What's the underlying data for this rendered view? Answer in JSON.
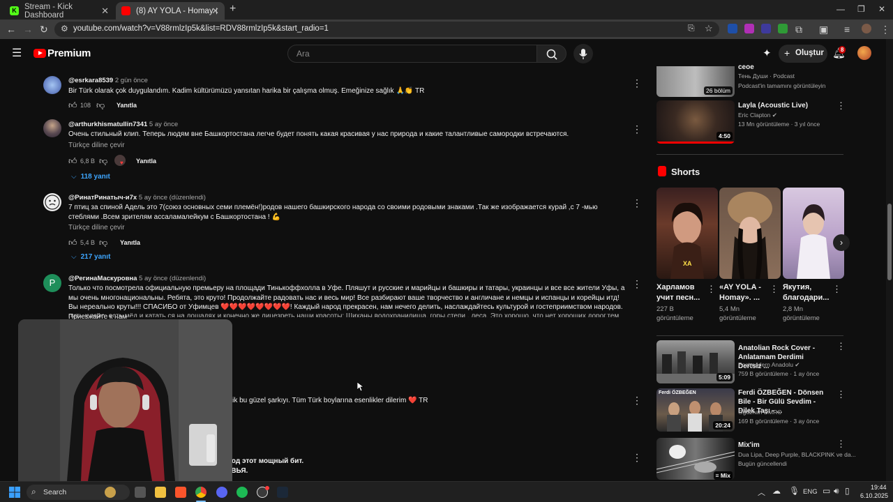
{
  "browser": {
    "tabs": [
      {
        "title": "Stream - Kick Dashboard",
        "active": false
      },
      {
        "title": "(8) AY YOLA - Homay (Премьер",
        "active": true
      }
    ],
    "url": "youtube.com/watch?v=V88rmlzIp5k&list=RDV88rmlzIp5k&start_radio=1"
  },
  "youtube": {
    "logo_text": "Premium",
    "search_placeholder": "Ara",
    "create_label": "Oluştur",
    "notification_count": "8"
  },
  "comments": [
    {
      "author": "@esrkara8539",
      "time": "2 gün önce",
      "text": "Bir Türk olarak çok duygulandım. Kadim kültürümüzü yansıtan harika bir çalışma olmuş. Emeğinize sağlık 🙏👏 TR",
      "likes": "108",
      "reply_label": "Yanıtla"
    },
    {
      "author": "@arthurkhismatullin7341",
      "time": "5 ay önce",
      "text": "Очень стильный клип. Теперь людям вне Башкортостана легче будет понять какая красивая у нас природа и какие талантливые самородки встречаются.",
      "translate": "Türkçe diline çevir",
      "likes": "6,8 B",
      "reply_label": "Yanıtla",
      "replies": "118 yanıt"
    },
    {
      "author": "@РинатРинатыч-и7х",
      "time": "5 ay önce (düzenlendi)",
      "text": "7 птиц за спиной Адель это 7(союз основных семи племён!)родов нашего башкирского народа со своими родовыми знаками .Так же изображается курай ,с 7 -мью стеблями .Всем зрителям ассаламалейкум с Башкортостана ! 💪",
      "translate": "Türkçe diline çevir",
      "likes": "5,4 B",
      "reply_label": "Yanıtla",
      "replies": "217 yanıt"
    },
    {
      "author": "@РегинаМаскуровна",
      "time": "5 ay önce (düzenlendi)",
      "text": "Только что посмотрела  официальную премьеру на площади Тинькоффхолла в Уфе. Пляшут и русские и марийцы и башкиры и татары, украинцы и все все жители Уфы, а мы очень многонациональны. Ребята, это круто! Продолжайте радовать нас  и весь мир! Все  разбирают  ваше творчество и англичане и немцы и испанцы и корейцы итд! Вы нереально круты!!! СПАСИБО от Уфимцев ❤️❤️❤️❤️❤️❤️❤️❤️! Каждый народ прекрасен, нам нечего делить, наслаждайтесь культурой и гостеприимством народов. Приезжайте к нам",
      "text_cut": "пить кумыс ,есть мёд и катать ся на лошадях и конечно же лицезреть наши красоты: Шиханы,водохранилища, горы,степи , леса. Это хорошо, что нет хороших дорог,тем самым эти ..."
    },
    {
      "text": "settik bu güzel şarkıyı. Tüm Türk boylarına esenlikler dilerim ❤️ TR"
    },
    {
      "text_line1": "р под этот мощный бит.",
      "text_line2": "РОВЬЯ."
    }
  ],
  "sidebar": {
    "top_items": [
      {
        "title": "сеое",
        "channel": "Тень Души · Podcast",
        "meta": "Podcast'in tamamını görüntüleyin",
        "badge": "26 bölüm"
      },
      {
        "title": "Layla (Acoustic Live)",
        "channel": "Eric Clapton",
        "meta": "13 Mn görüntüleme · 3 yıl önce",
        "duration": "4:50"
      }
    ],
    "shorts_header": "Shorts",
    "shorts": [
      {
        "title": "Харламов учит песн...",
        "views": "227 B görüntüleme",
        "overlay": "ХА"
      },
      {
        "title": "«AY YOLA - Homay». ...",
        "views": "5,4 Mn görüntüleme"
      },
      {
        "title": "Якутия, благодари...",
        "views": "2,8 Mn görüntüleme"
      }
    ],
    "bottom_items": [
      {
        "title": "Anatolian Rock Cover - Anlatamam Derdimi Dertsiz ...",
        "channel": "Postmodern Anadolu",
        "meta": "759 B görüntüleme · 1 ay önce",
        "duration": "5:09"
      },
      {
        "title": "Ferdi ÖZBEĞEN - Dönsen Bile - Bir Gülü Sevdim - Dilek Taşı - ...",
        "channel": "Oğuzhan DMRC",
        "meta": "169 B görüntüleme · 3 ay önce",
        "duration": "20:24",
        "thumb_text": "Ferdi ÖZBEĞEN"
      },
      {
        "title": "Mix'im",
        "channel": "Dua Lipa, Deep Purple, BLACKPINK ve da...",
        "meta": "Bugün güncellendi",
        "duration": "Mix"
      }
    ]
  },
  "taskbar": {
    "search_label": "Search",
    "lang": "ENG",
    "time": "19:44",
    "date": "6.10.2025"
  }
}
